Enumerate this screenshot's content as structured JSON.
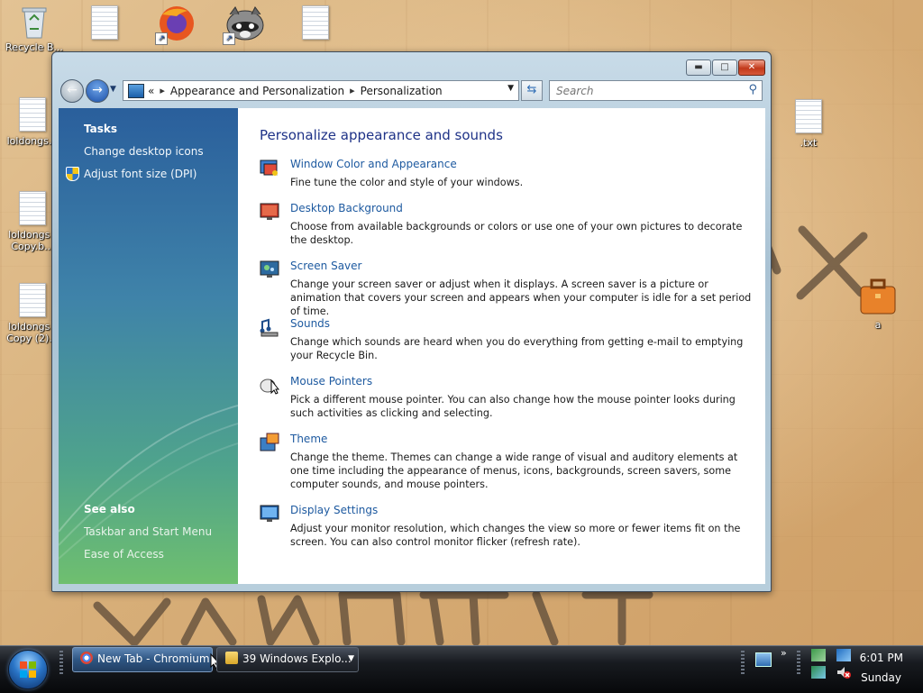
{
  "desktop": {
    "icons": [
      {
        "label": "Recycle B..."
      },
      {
        "label": ""
      },
      {
        "label": ""
      },
      {
        "label": ""
      },
      {
        "label": ""
      },
      {
        "label": "loldongs..."
      },
      {
        "label": "loldongs - Copy.b..."
      },
      {
        "label": "loldongs - Copy (2)..."
      },
      {
        "label": ".txt"
      },
      {
        "label": "a"
      }
    ]
  },
  "window": {
    "caption_buttons": {
      "minimize": "▬",
      "maximize": "□",
      "close": "✕"
    },
    "breadcrumb": {
      "overflow": "«",
      "items": [
        "Appearance and Personalization",
        "Personalization"
      ]
    },
    "search_placeholder": "Search",
    "tasks": {
      "heading": "Tasks",
      "links": [
        "Change desktop icons",
        "Adjust font size (DPI)"
      ]
    },
    "see_also": {
      "heading": "See also",
      "links": [
        "Taskbar and Start Menu",
        "Ease of Access"
      ]
    },
    "content": {
      "title": "Personalize appearance and sounds",
      "items": [
        {
          "title": "Window Color and Appearance",
          "desc": "Fine tune the color and style of your windows.",
          "icon": "window-color-icon"
        },
        {
          "title": "Desktop Background",
          "desc": "Choose from available backgrounds or colors or use one of your own pictures to decorate the desktop.",
          "icon": "desktop-background-icon"
        },
        {
          "title": "Screen Saver",
          "desc": "Change your screen saver or adjust when it displays. A screen saver is a picture or animation that covers your screen and appears when your computer is idle for a set period of time.",
          "icon": "screen-saver-icon"
        },
        {
          "title": "Sounds",
          "desc": "Change which sounds are heard when you do everything from getting e-mail to emptying your Recycle Bin.",
          "icon": "sounds-icon"
        },
        {
          "title": "Mouse Pointers",
          "desc": "Pick a different mouse pointer. You can also change how the mouse pointer looks during such activities as clicking and selecting.",
          "icon": "mouse-pointers-icon"
        },
        {
          "title": "Theme",
          "desc": "Change the theme. Themes can change a wide range of visual and auditory elements at one time including the appearance of menus, icons, backgrounds, screen savers, some computer sounds, and mouse pointers.",
          "icon": "theme-icon"
        },
        {
          "title": "Display Settings",
          "desc": "Adjust your monitor resolution, which changes the view so more or fewer items fit on the screen. You can also control monitor flicker (refresh rate).",
          "icon": "display-settings-icon"
        }
      ]
    }
  },
  "taskbar": {
    "buttons": [
      {
        "label": "New Tab - Chromium"
      },
      {
        "label": "39 Windows Explo..."
      }
    ],
    "tray_overflow": "»",
    "clock": {
      "time": "6:01 PM",
      "day": "Sunday"
    }
  },
  "colors": {
    "link": "#1e5aa0",
    "heading": "#1e3287",
    "sidebar_top": "#2a5f9c",
    "sidebar_bottom": "#6fbf6f"
  }
}
